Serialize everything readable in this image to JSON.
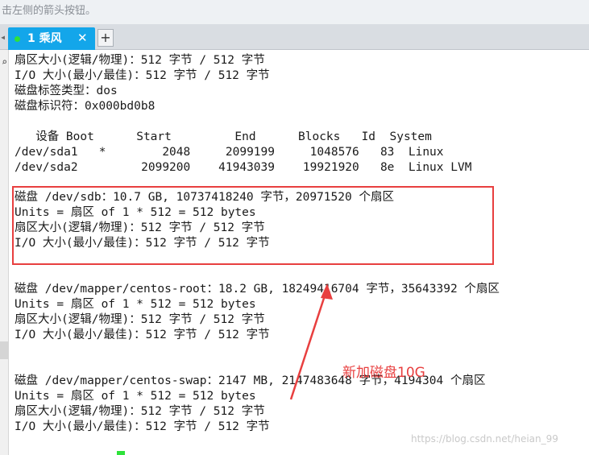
{
  "hint_bar": {
    "text": "击左侧的箭头按钮。"
  },
  "tabs": [
    {
      "label": "1 乘风",
      "close": "✕"
    }
  ],
  "tab_add_label": "+",
  "terminal_lines": [
    "扇区大小(逻辑/物理)：512 字节 / 512 字节",
    "I/O 大小(最小/最佳)：512 字节 / 512 字节",
    "磁盘标签类型：dos",
    "磁盘标识符：0x000bd0b8",
    "",
    "   设备 Boot      Start         End      Blocks   Id  System",
    "/dev/sda1   *        2048     2099199     1048576   83  Linux",
    "/dev/sda2         2099200    41943039    19921920   8e  Linux LVM",
    "",
    "磁盘 /dev/sdb：10.7 GB, 10737418240 字节，20971520 个扇区",
    "Units = 扇区 of 1 * 512 = 512 bytes",
    "扇区大小(逻辑/物理)：512 字节 / 512 字节",
    "I/O 大小(最小/最佳)：512 字节 / 512 字节",
    "",
    "",
    "磁盘 /dev/mapper/centos-root：18.2 GB, 18249416704 字节，35643392 个扇区",
    "Units = 扇区 of 1 * 512 = 512 bytes",
    "扇区大小(逻辑/物理)：512 字节 / 512 字节",
    "I/O 大小(最小/最佳)：512 字节 / 512 字节",
    "",
    "",
    "磁盘 /dev/mapper/centos-swap：2147 MB, 2147483648 字节，4194304 个扇区",
    "Units = 扇区 of 1 * 512 = 512 bytes",
    "扇区大小(逻辑/物理)：512 字节 / 512 字节",
    "I/O 大小(最小/最佳)：512 字节 / 512 字节"
  ],
  "annotation": {
    "text": "新加磁盘10G",
    "color": "#e83f3f"
  },
  "watermark": "https://blog.csdn.net/heian_99",
  "colors": {
    "tab_active": "#13a6ea",
    "cursor": "#2ee23a",
    "highlight_box": "#e83f3f"
  }
}
